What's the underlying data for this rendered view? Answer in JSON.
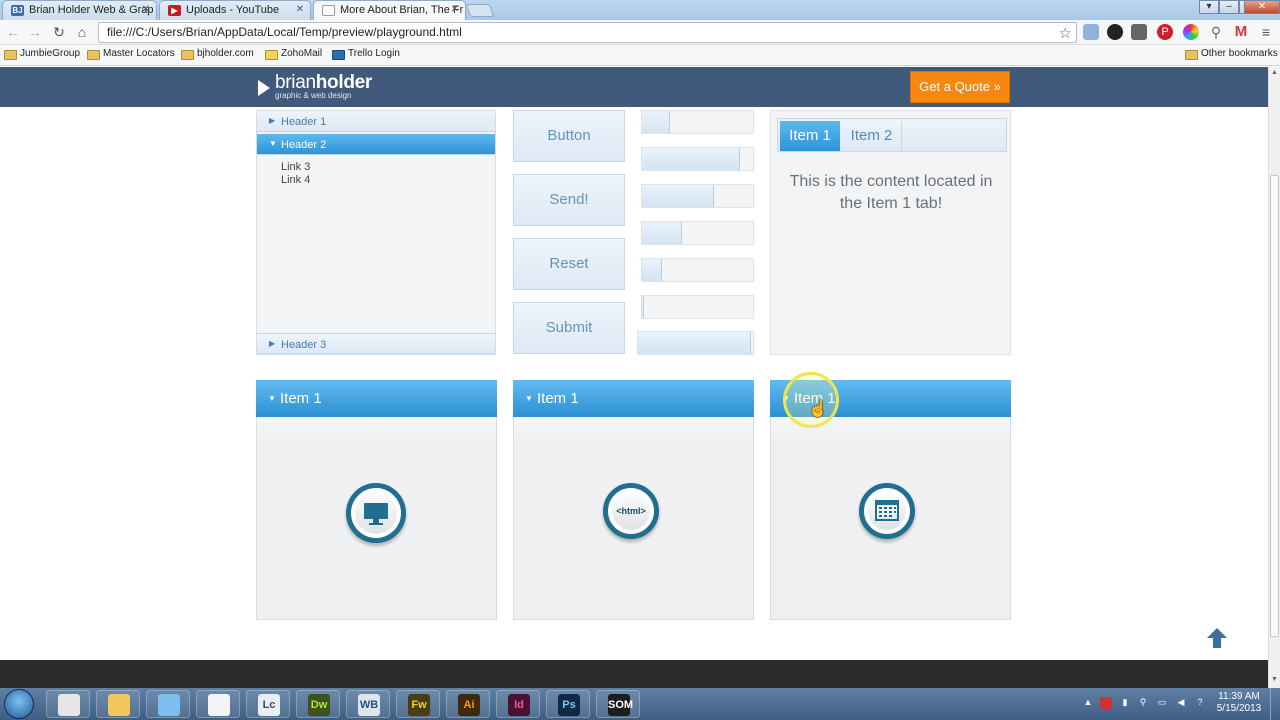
{
  "browser": {
    "tabs": [
      {
        "label": "Brian Holder Web & Grap",
        "favicon": "BJ",
        "favicon_color": "#3d6aa8"
      },
      {
        "label": "Uploads - YouTube",
        "favicon": "▶",
        "favicon_color": "#cc181e"
      },
      {
        "label": "More About Brian, The Fr",
        "favicon": "",
        "favicon_color": "#9a9a9a",
        "active": true
      }
    ],
    "url": "file:///C:/Users/Brian/AppData/Local/Temp/preview/playground.html",
    "bookmarks": [
      "JumbieGroup",
      "Master Locators",
      "bjholder.com",
      "ZohoMail",
      "Trello Login"
    ],
    "other_bookmarks": "Other bookmarks",
    "extension_icons": [
      "rss-icon",
      "browser-icon",
      "camera-icon",
      "keyboard-icon",
      "pinterest-icon",
      "color-wheel-icon",
      "search-icon",
      "gmail-icon",
      "menu-icon"
    ]
  },
  "site": {
    "logo_name_light": "brian",
    "logo_name_bold": "holder",
    "logo_tagline": "graphic & web design",
    "quote_button": "Get a Quote »",
    "header_color": "#41597b",
    "accent_orange": "#f7870f",
    "accent_blue": "#2d93d6"
  },
  "accordion": {
    "header1": "Header 1",
    "header2": "Header 2",
    "header3": "Header 3",
    "links": [
      "Link 3",
      "Link 4"
    ]
  },
  "buttons": [
    "Button",
    "Send!",
    "Reset",
    "Submit"
  ],
  "progress_bars": [
    0.25,
    0.88,
    0.65,
    0.36,
    0.18,
    0.02,
    0.98
  ],
  "tabs_widget": {
    "tab1": "Item 1",
    "tab2": "Item 2",
    "content": "This is the content located in the Item 1 tab!"
  },
  "panels": [
    {
      "title": "Item 1",
      "icon": "monitor-icon"
    },
    {
      "title": "Item 1",
      "icon": "html-icon",
      "icon_text": "<html>"
    },
    {
      "title": "Item 1",
      "icon": "calendar-icon"
    }
  ],
  "taskbar": {
    "apps": [
      {
        "name": "chrome",
        "label": "",
        "bg": "#e6e6e6",
        "fg": "#222"
      },
      {
        "name": "explorer",
        "label": "",
        "bg": "#f0c75a",
        "fg": "#222"
      },
      {
        "name": "installer",
        "label": "",
        "bg": "#7dbdf0",
        "fg": "#222"
      },
      {
        "name": "acrobat",
        "label": "",
        "bg": "#f4f4f4",
        "fg": "#c0201b"
      },
      {
        "name": "livecycle",
        "label": "Lc",
        "bg": "#e9eef3",
        "fg": "#2a4f7a"
      },
      {
        "name": "dreamweaver",
        "label": "Dw",
        "bg": "#3d5416",
        "fg": "#b3e04b"
      },
      {
        "name": "webboard",
        "label": "WB",
        "bg": "#dfe4ea",
        "fg": "#2a4f7a"
      },
      {
        "name": "fireworks",
        "label": "Fw",
        "bg": "#4a3d12",
        "fg": "#f3d028"
      },
      {
        "name": "illustrator",
        "label": "Ai",
        "bg": "#3f2a0e",
        "fg": "#f39f1e"
      },
      {
        "name": "indesign",
        "label": "Id",
        "bg": "#4a1230",
        "fg": "#f0589b"
      },
      {
        "name": "photoshop",
        "label": "Ps",
        "bg": "#0f2a44",
        "fg": "#7cc3f5"
      },
      {
        "name": "som",
        "label": "SOM",
        "bg": "#1d1d1d",
        "fg": "#fff"
      }
    ],
    "time": "11:39 AM",
    "date": "5/15/2013"
  }
}
